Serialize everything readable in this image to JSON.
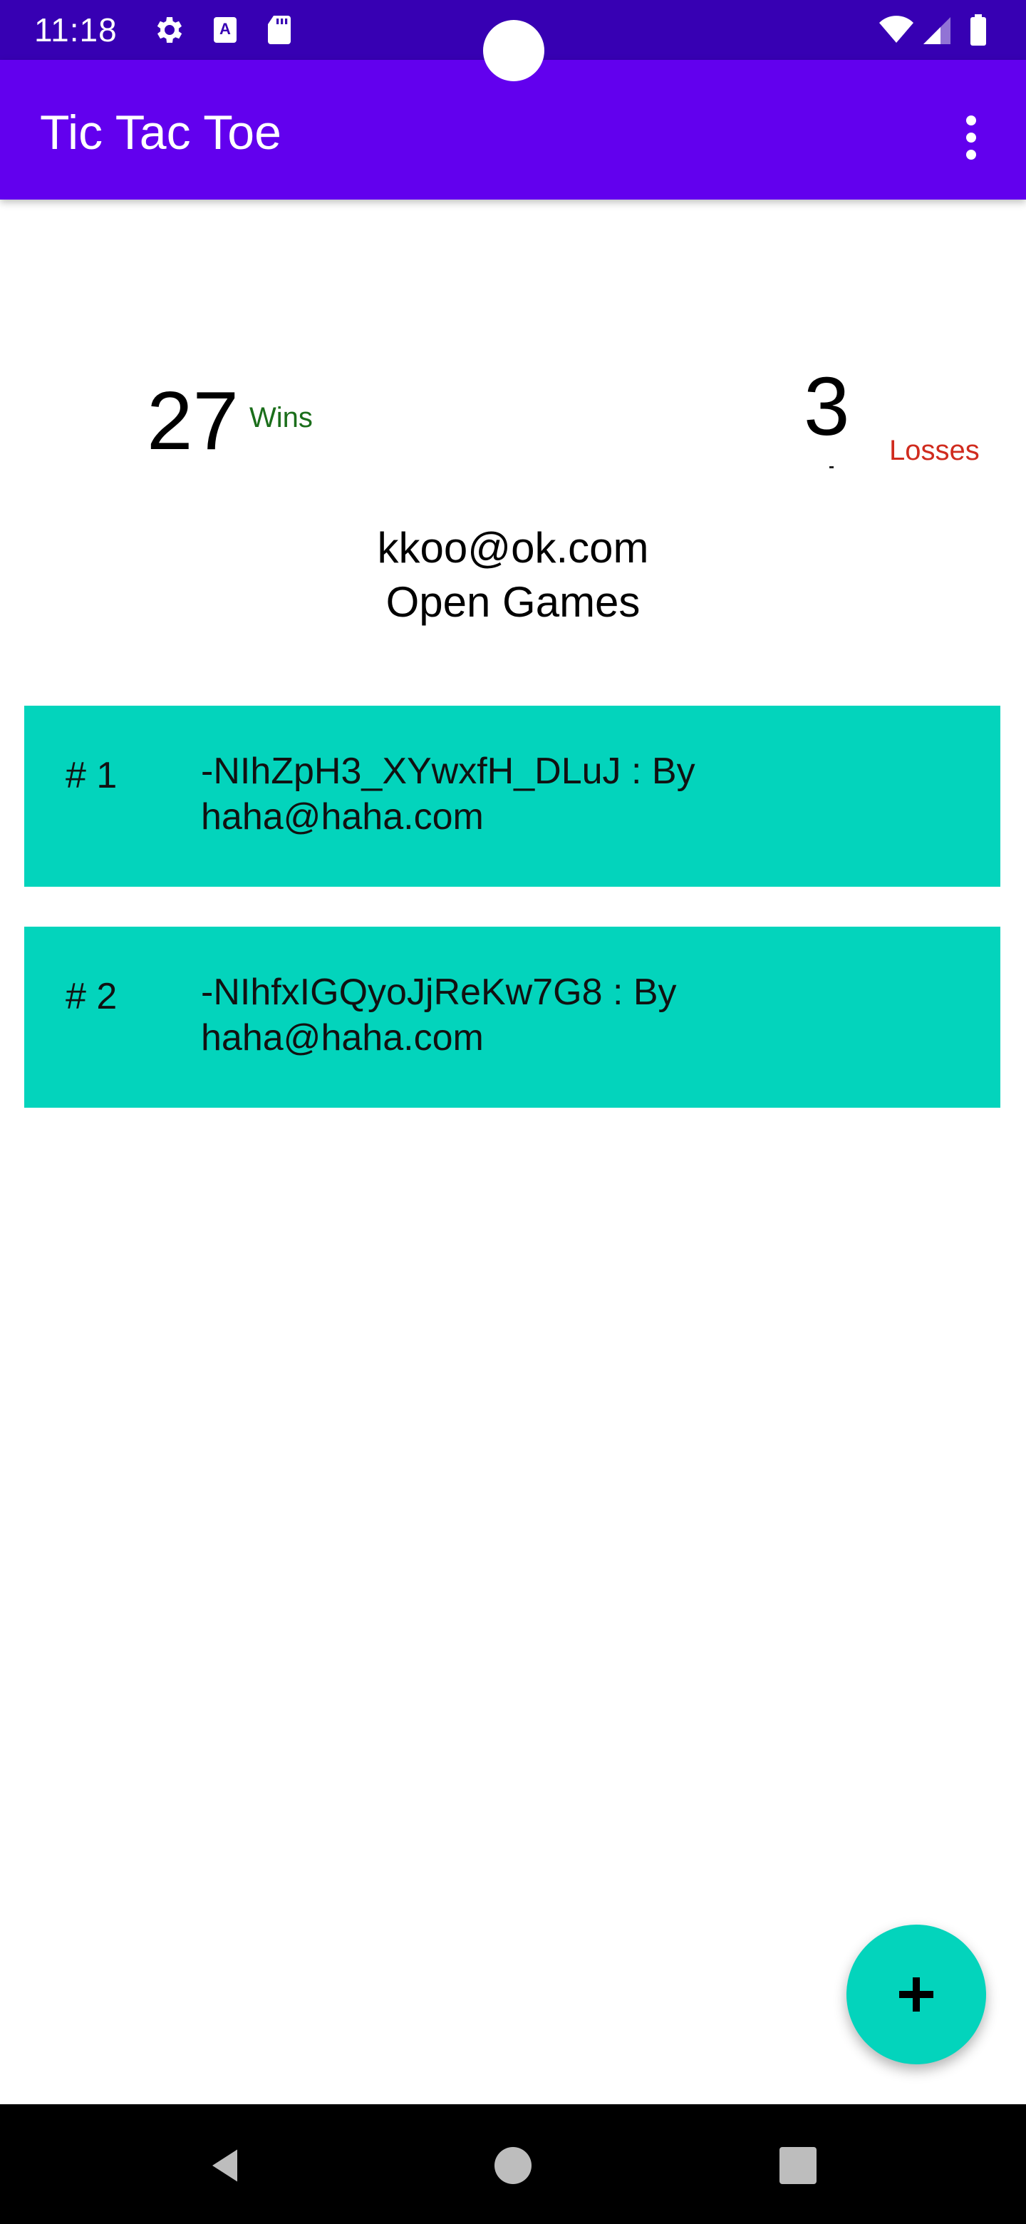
{
  "status_bar": {
    "time": "11:18",
    "icons": [
      "gear-icon",
      "a-keyboard-icon",
      "sd-card-icon",
      "wifi-icon",
      "cell-signal-icon",
      "battery-icon"
    ]
  },
  "app_bar": {
    "title": "Tic Tac Toe",
    "menu_icon": "more-vert-icon"
  },
  "stats": {
    "wins_count": "27",
    "wins_label": "Wins",
    "losses_count": "3",
    "losses_label": "Losses"
  },
  "user": {
    "email": "kkoo@ok.com"
  },
  "open_games": {
    "title": "Open Games",
    "items": [
      {
        "number": "# 1",
        "text": "-NIhZpH3_XYwxfH_DLuJ : By\nhaha@haha.com"
      },
      {
        "number": "# 2",
        "text": "-NIhfxIGQyoJjReKw7G8 : By\nhaha@haha.com"
      }
    ]
  },
  "fab": {
    "icon": "plus-icon"
  },
  "colors": {
    "status_bar": "#3700b3",
    "app_bar": "#6200ee",
    "card": "#03d4bc",
    "wins": "#1b6e1b",
    "losses": "#d02b1e"
  }
}
